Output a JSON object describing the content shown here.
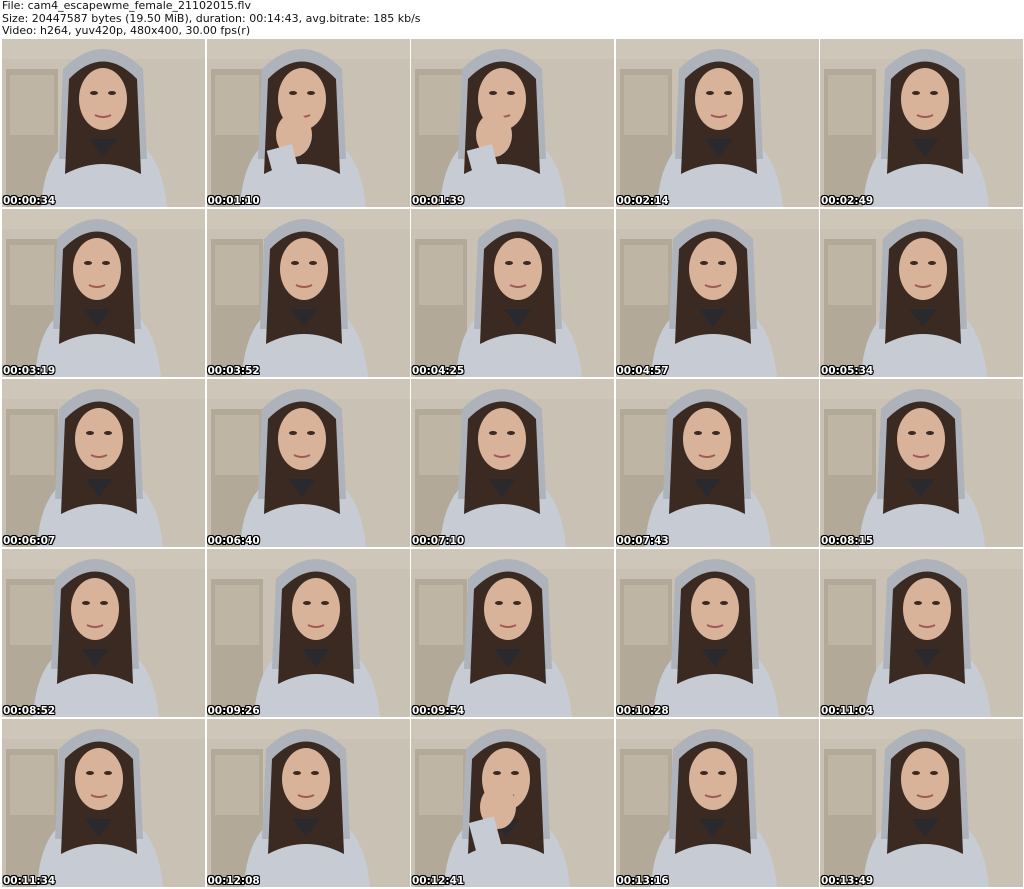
{
  "header": {
    "file_line": "File: cam4_escapewme_female_21102015.flv",
    "size_line": "Size: 20447587 bytes (19.50 MiB), duration: 00:14:43, avg.bitrate: 185 kb/s",
    "video_line": "Video: h264, yuv420p, 480x400, 30.00 fps(r)"
  },
  "thumbnails": [
    {
      "timestamp": "00:00:34"
    },
    {
      "timestamp": "00:01:10"
    },
    {
      "timestamp": "00:01:39"
    },
    {
      "timestamp": "00:02:14"
    },
    {
      "timestamp": "00:02:49"
    },
    {
      "timestamp": "00:03:19"
    },
    {
      "timestamp": "00:03:52"
    },
    {
      "timestamp": "00:04:25"
    },
    {
      "timestamp": "00:04:57"
    },
    {
      "timestamp": "00:05:34"
    },
    {
      "timestamp": "00:06:07"
    },
    {
      "timestamp": "00:06:40"
    },
    {
      "timestamp": "00:07:10"
    },
    {
      "timestamp": "00:07:43"
    },
    {
      "timestamp": "00:08:15"
    },
    {
      "timestamp": "00:08:52"
    },
    {
      "timestamp": "00:09:26"
    },
    {
      "timestamp": "00:09:54"
    },
    {
      "timestamp": "00:10:28"
    },
    {
      "timestamp": "00:11:04"
    },
    {
      "timestamp": "00:11:34"
    },
    {
      "timestamp": "00:12:08"
    },
    {
      "timestamp": "00:12:41"
    },
    {
      "timestamp": "00:13:16"
    },
    {
      "timestamp": "00:13:49"
    }
  ],
  "colors": {
    "wall": "#c9c1b3",
    "door": "#b3a998",
    "hoodie": "#c7ccd4",
    "hair": "#3a2a22",
    "skin": "#d9b29a"
  }
}
